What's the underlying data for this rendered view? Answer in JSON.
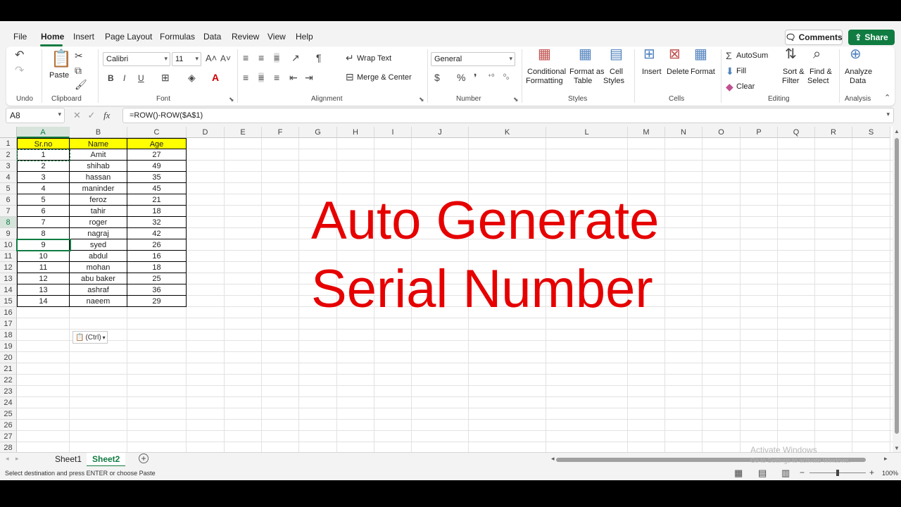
{
  "menu": {
    "tabs": [
      "File",
      "Home",
      "Insert",
      "Page Layout",
      "Formulas",
      "Data",
      "Review",
      "View",
      "Help"
    ],
    "active_tab": "Home",
    "comments_label": "Comments",
    "share_label": "Share"
  },
  "ribbon": {
    "undo_group": "Undo",
    "clipboard": {
      "paste_label": "Paste",
      "group_label": "Clipboard"
    },
    "font": {
      "name": "Calibri",
      "size": "11",
      "group_label": "Font",
      "bold": "B",
      "italic": "I",
      "underline": "U"
    },
    "alignment": {
      "wrap_text": "Wrap Text",
      "merge_center": "Merge & Center",
      "group_label": "Alignment"
    },
    "number": {
      "format": "General",
      "group_label": "Number"
    },
    "styles": {
      "conditional_formatting": "Conditional",
      "conditional_formatting_2": "Formatting",
      "format_as_table": "Format as",
      "format_as_table_2": "Table",
      "cell_styles": "Cell",
      "cell_styles_2": "Styles",
      "group_label": "Styles"
    },
    "cells": {
      "insert": "Insert",
      "delete": "Delete",
      "format": "Format",
      "group_label": "Cells"
    },
    "editing": {
      "autosum": "AutoSum",
      "fill": "Fill",
      "clear": "Clear",
      "sort_filter": "Sort &",
      "sort_filter_2": "Filter",
      "find_select": "Find &",
      "find_select_2": "Select",
      "group_label": "Editing"
    },
    "analysis": {
      "analyze_data": "Analyze",
      "analyze_data_2": "Data",
      "group_label": "Analysis"
    }
  },
  "formula_bar": {
    "name_box": "A8",
    "fx": "fx",
    "formula": "=ROW()-ROW($A$1)"
  },
  "columns": [
    "A",
    "B",
    "C",
    "D",
    "E",
    "F",
    "G",
    "H",
    "I",
    "J",
    "K",
    "L",
    "M",
    "N",
    "O",
    "P",
    "Q",
    "R",
    "S"
  ],
  "rows": [
    "1",
    "2",
    "3",
    "4",
    "5",
    "6",
    "7",
    "8",
    "9",
    "10",
    "11",
    "12",
    "13",
    "14",
    "15",
    "16",
    "17",
    "18",
    "19",
    "20",
    "21",
    "22",
    "23",
    "24",
    "25",
    "26",
    "27",
    "28"
  ],
  "table": {
    "headers": [
      "Sr.no",
      "Name",
      "Age"
    ],
    "rows": [
      [
        "1",
        "Amit",
        "27"
      ],
      [
        "2",
        "shihab",
        "49"
      ],
      [
        "3",
        "hassan",
        "35"
      ],
      [
        "4",
        "maninder",
        "45"
      ],
      [
        "5",
        "feroz",
        "21"
      ],
      [
        "6",
        "tahir",
        "18"
      ],
      [
        "7",
        "roger",
        "32"
      ],
      [
        "8",
        "nagraj",
        "42"
      ],
      [
        "9",
        "syed",
        "26"
      ],
      [
        "10",
        "abdul",
        "16"
      ],
      [
        "11",
        "mohan",
        "18"
      ],
      [
        "12",
        "abu baker",
        "25"
      ],
      [
        "13",
        "ashraf",
        "36"
      ],
      [
        "14",
        "naeem",
        "29"
      ]
    ]
  },
  "paste_options": "(Ctrl)",
  "overlay": {
    "line1": "Auto Generate",
    "line2": "Serial Number"
  },
  "sheets": {
    "tabs": [
      "Sheet1",
      "Sheet2"
    ],
    "active": "Sheet2"
  },
  "status": {
    "message": "Select destination and press ENTER or choose Paste",
    "zoom": "100%"
  },
  "watermark": {
    "line1": "Activate Windows",
    "line2": "Go to Settings to activate Windows."
  },
  "colors": {
    "accent": "#107c41",
    "header_fill": "#ffff00",
    "overlay_text": "#e60000"
  }
}
